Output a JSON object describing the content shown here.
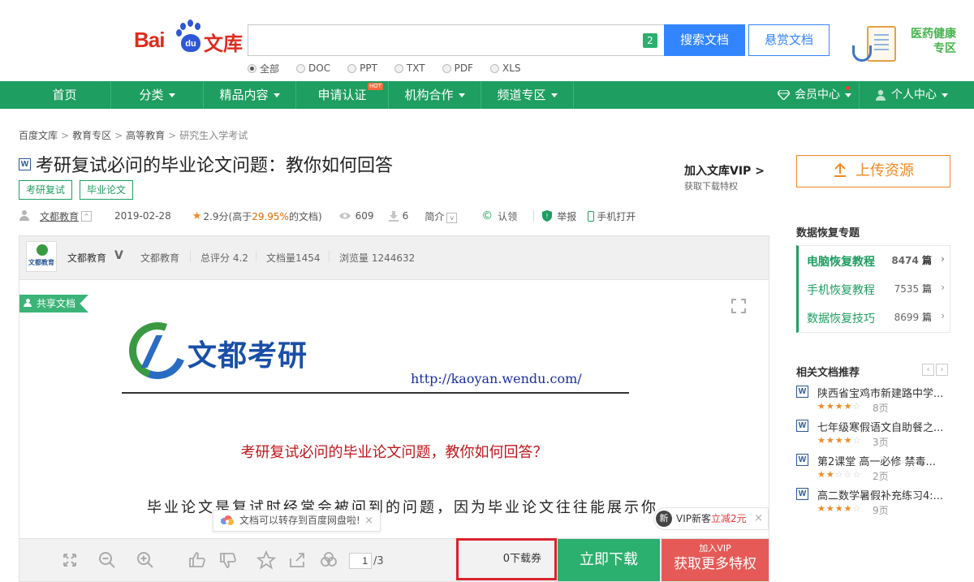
{
  "colors": {
    "brand_green": "#1e9e60",
    "search_blue": "#3385ff",
    "upload_orange": "#f08a24",
    "vip_red": "#e55a57",
    "highlight_orange": "#e16b00"
  },
  "header": {
    "logo_text_bai": "Bai",
    "logo_text_du": "du",
    "logo_text_wenku": "文库",
    "search": {
      "value": "",
      "placeholder": "",
      "count_badge": "2"
    },
    "search_button": "搜索文档",
    "reward_button": "悬赏文档",
    "filters": [
      {
        "label": "全部",
        "selected": true
      },
      {
        "label": "DOC",
        "selected": false
      },
      {
        "label": "PPT",
        "selected": false
      },
      {
        "label": "TXT",
        "selected": false
      },
      {
        "label": "PDF",
        "selected": false
      },
      {
        "label": "XLS",
        "selected": false
      }
    ],
    "promo": {
      "line1": "医药健康",
      "line2": "专区",
      "icon": "clipboard-stethoscope-icon"
    }
  },
  "nav": {
    "items": [
      {
        "label": "首页",
        "has_caret": false
      },
      {
        "label": "分类",
        "has_caret": true
      },
      {
        "label": "精品内容",
        "has_caret": true
      },
      {
        "label": "申请认证",
        "has_caret": false,
        "badge": "HOT"
      },
      {
        "label": "机构合作",
        "has_caret": true
      },
      {
        "label": "频道专区",
        "has_caret": true
      }
    ],
    "member_center": "会员中心",
    "personal_center": "个人中心"
  },
  "breadcrumb": [
    "百度文库",
    "教育专区",
    "高等教育",
    "研究生入学考试"
  ],
  "doc": {
    "type_icon": "W",
    "title": "考研复试必问的毕业论文问题：教你如何回答",
    "tags": [
      "考研复试",
      "毕业论文"
    ],
    "meta": {
      "author": "文都教育",
      "date": "2019-02-28",
      "score_prefix": "2.9分(高于",
      "score_pct": "29.95%",
      "score_suffix": "的文档)",
      "views": "609",
      "downloads": "6",
      "intro": "简介",
      "claim": "认领",
      "report": "举报",
      "mobile": "手机打开"
    }
  },
  "vip_join": {
    "title": "加入文库VIP",
    "arrow": ">",
    "subtitle": "获取下载特权"
  },
  "author_bar": {
    "logo_text": "文都教育",
    "name": "文都教育",
    "v_mark": "V",
    "org": "文都教育",
    "total_score": "总评分 4.2",
    "doc_count": "文档量1454",
    "view_count": "浏览量 1244632"
  },
  "page": {
    "share_flag": "共享文档",
    "wd_logo_text": "文都考研",
    "url": "http://kaoyan.wendu.com/",
    "heading": "考研复试必问的毕业论文问题，教你如何回答？",
    "body": "毕业论文是复试时经常会被问到的问题，因为毕业论文往往能展示你"
  },
  "toasts": {
    "netdisk": "文档可以转存到百度网盘啦!",
    "close": "×",
    "vip_badge": "新",
    "vip_prefix": "VIP新客",
    "vip_red": "立减2元"
  },
  "toolbar": {
    "current_page": "1",
    "total_pages": "/3",
    "voucher": "0下载券",
    "download": "立即下载",
    "vip_small": "加入VIP",
    "vip_big": "获取更多特权"
  },
  "sidebar": {
    "upload": "上传资源",
    "recover_title": "数据恢复专题",
    "recover_items": [
      {
        "label": "电脑恢复教程",
        "count": "8474",
        "unit": "篇",
        "bold": true
      },
      {
        "label": "手机恢复教程",
        "count": "7535",
        "unit": "篇",
        "bold": false
      },
      {
        "label": "数据恢复技巧",
        "count": "8699",
        "unit": "篇",
        "bold": false
      }
    ],
    "related_title": "相关文档推荐",
    "related": [
      {
        "title": "陕西省宝鸡市新建路中学...",
        "rating": 4,
        "pages": "8页"
      },
      {
        "title": "七年级寒假语文自助餐之...",
        "rating": 4,
        "pages": "3页"
      },
      {
        "title": "第2课堂 高一必修 禁毒...",
        "rating": 2,
        "pages": "2页"
      },
      {
        "title": "高二数学暑假补充练习4:...",
        "rating": 4,
        "pages": "9页"
      }
    ]
  }
}
